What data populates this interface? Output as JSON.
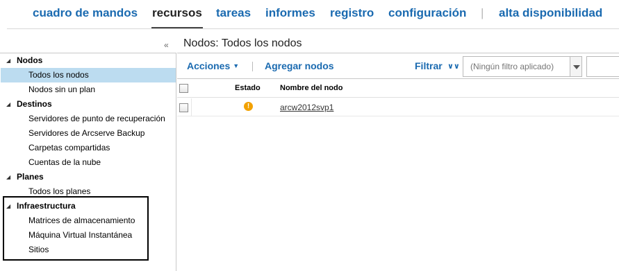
{
  "topnav": {
    "items": [
      {
        "label": "cuadro de mandos",
        "active": false
      },
      {
        "label": "recursos",
        "active": true
      },
      {
        "label": "tareas",
        "active": false
      },
      {
        "label": "informes",
        "active": false
      },
      {
        "label": "registro",
        "active": false
      },
      {
        "label": "configuración",
        "active": false
      },
      {
        "label": "alta disponibilidad",
        "active": false
      }
    ],
    "separator": "|"
  },
  "header": {
    "collapse_glyph": "«",
    "title": "Nodos: Todos los nodos"
  },
  "tree": {
    "groups": [
      {
        "label": "Nodos",
        "items": [
          {
            "label": "Todos los nodos",
            "selected": true
          },
          {
            "label": "Nodos sin un plan"
          }
        ]
      },
      {
        "label": "Destinos",
        "items": [
          {
            "label": "Servidores de punto de recuperación"
          },
          {
            "label": "Servidores de Arcserve Backup"
          },
          {
            "label": "Carpetas compartidas"
          },
          {
            "label": "Cuentas de la nube"
          }
        ]
      },
      {
        "label": "Planes",
        "items": [
          {
            "label": "Todos los planes"
          }
        ]
      },
      {
        "label": "Infraestructura",
        "items": [
          {
            "label": "Matrices de almacenamiento"
          },
          {
            "label": "Máquina Virtual Instantánea"
          },
          {
            "label": "Sitios"
          }
        ]
      }
    ]
  },
  "toolbar": {
    "actions_label": "Acciones",
    "add_nodes_label": "Agregar nodos",
    "filter_label": "Filtrar",
    "filter_placeholder": "(Ningún filtro aplicado)"
  },
  "grid": {
    "columns": {
      "status": "Estado",
      "node_name": "Nombre del nodo"
    },
    "rows": [
      {
        "status_icon": "warning-icon",
        "node_name": "arcw2012svp1"
      }
    ]
  },
  "colors": {
    "link_blue": "#1a6ab0",
    "selected_row": "#bcdcf0",
    "warning": "#f2a100"
  }
}
